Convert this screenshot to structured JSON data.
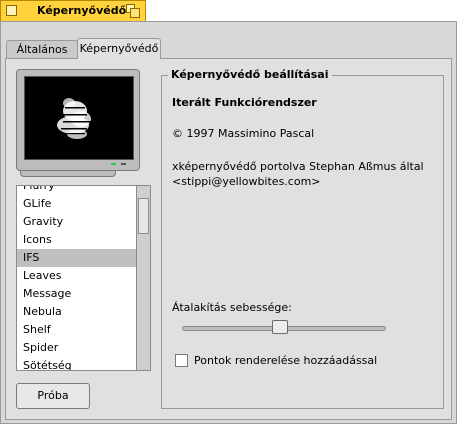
{
  "window": {
    "title": "Képernyővédő"
  },
  "tabs": [
    {
      "label": "Általános",
      "active": false
    },
    {
      "label": "Képernyővédő",
      "active": true
    }
  ],
  "screensavers": {
    "items": [
      "Flurry",
      "GLife",
      "Gravity",
      "Icons",
      "IFS",
      "Leaves",
      "Message",
      "Nebula",
      "Shelf",
      "Spider",
      "Sötétség"
    ],
    "selected": "IFS"
  },
  "test_button_label": "Próba",
  "settings": {
    "group_title": "Képernyővédő beállításai",
    "module_name": "Iterált Funkciórendszer",
    "copyright": "© 1997 Massimino Pascal",
    "port_info": "xképernyővédő portolva Stephan Aßmus által <stippi@yellowbites.com>",
    "speed_label": "Átalakítás sebessége:",
    "speed_value_fraction": 0.48,
    "render_points_label": "Pontok renderelése hozzáadással",
    "render_points_checked": false
  },
  "colors": {
    "title_tab": "#ffd23e",
    "panel": "#e0e0e0",
    "selection": "#bfbfbf"
  }
}
